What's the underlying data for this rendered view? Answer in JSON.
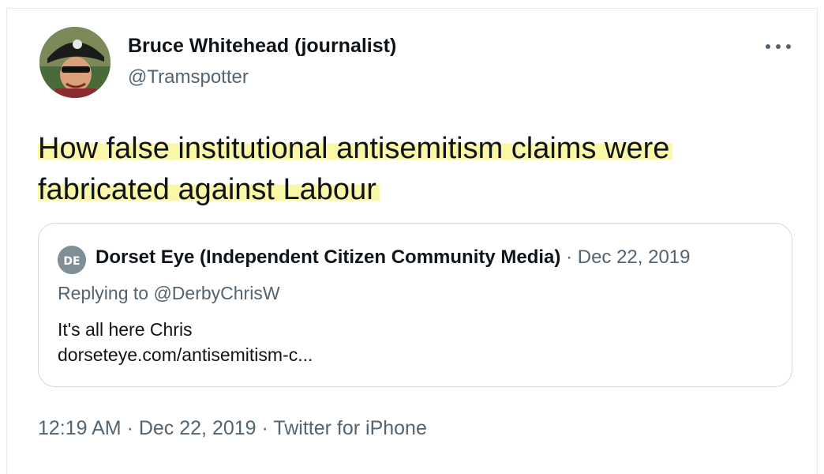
{
  "tweet": {
    "author_name": "Bruce Whitehead (journalist)",
    "author_handle": "@Tramspotter",
    "more_icon": "more-horizontal-icon",
    "text_line1": "How false institutional antisemitism claims were",
    "text_line2": "fabricated against Labour",
    "highlight_color": "#fbf7a8"
  },
  "quote": {
    "author_name": "Dorset Eye (Independent Citizen Community Media)",
    "meta": " · Dec 22, 2019",
    "replying": "Replying to @DerbyChrisW",
    "text": "It's all here Chris",
    "link": "dorseteye.com/antisemitism-c..."
  },
  "footer": {
    "timestamp": "12:19 AM · Dec 22, 2019 · Twitter for iPhone"
  }
}
